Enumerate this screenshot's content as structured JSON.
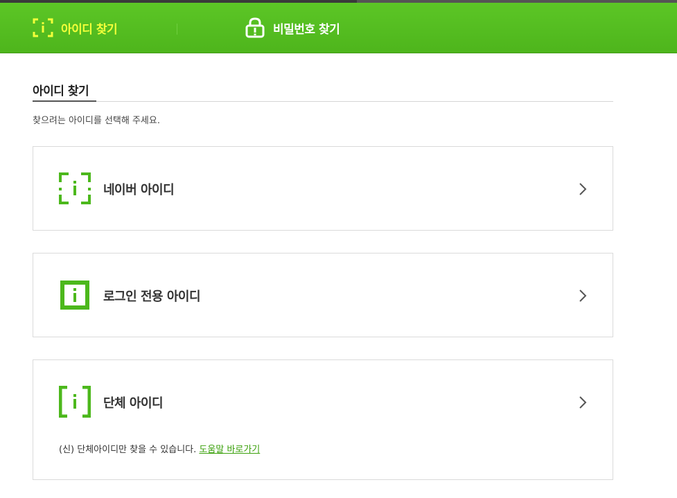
{
  "header": {
    "tabs": [
      {
        "label": "아이디 찾기",
        "active": true,
        "icon": "id-bracket-icon"
      },
      {
        "label": "비밀번호 찾기",
        "active": false,
        "icon": "lock-alert-icon"
      }
    ]
  },
  "main": {
    "title": "아이디 찾기",
    "description": "찾으려는 아이디를 선택해 주세요.",
    "options": [
      {
        "label": "네이버 아이디",
        "icon": "naver-id-icon"
      },
      {
        "label": "로그인 전용 아이디",
        "icon": "login-only-id-icon"
      },
      {
        "label": "단체 아이디",
        "icon": "group-id-icon",
        "note": "(신) 단체아이디만 찾을 수 있습니다.",
        "help_link": "도움말 바로가기"
      }
    ]
  },
  "colors": {
    "header_green": "#52bb20",
    "active_tab_text": "#f2ff3a",
    "icon_green": "#4cb81c",
    "link_green": "#3aa00a"
  }
}
